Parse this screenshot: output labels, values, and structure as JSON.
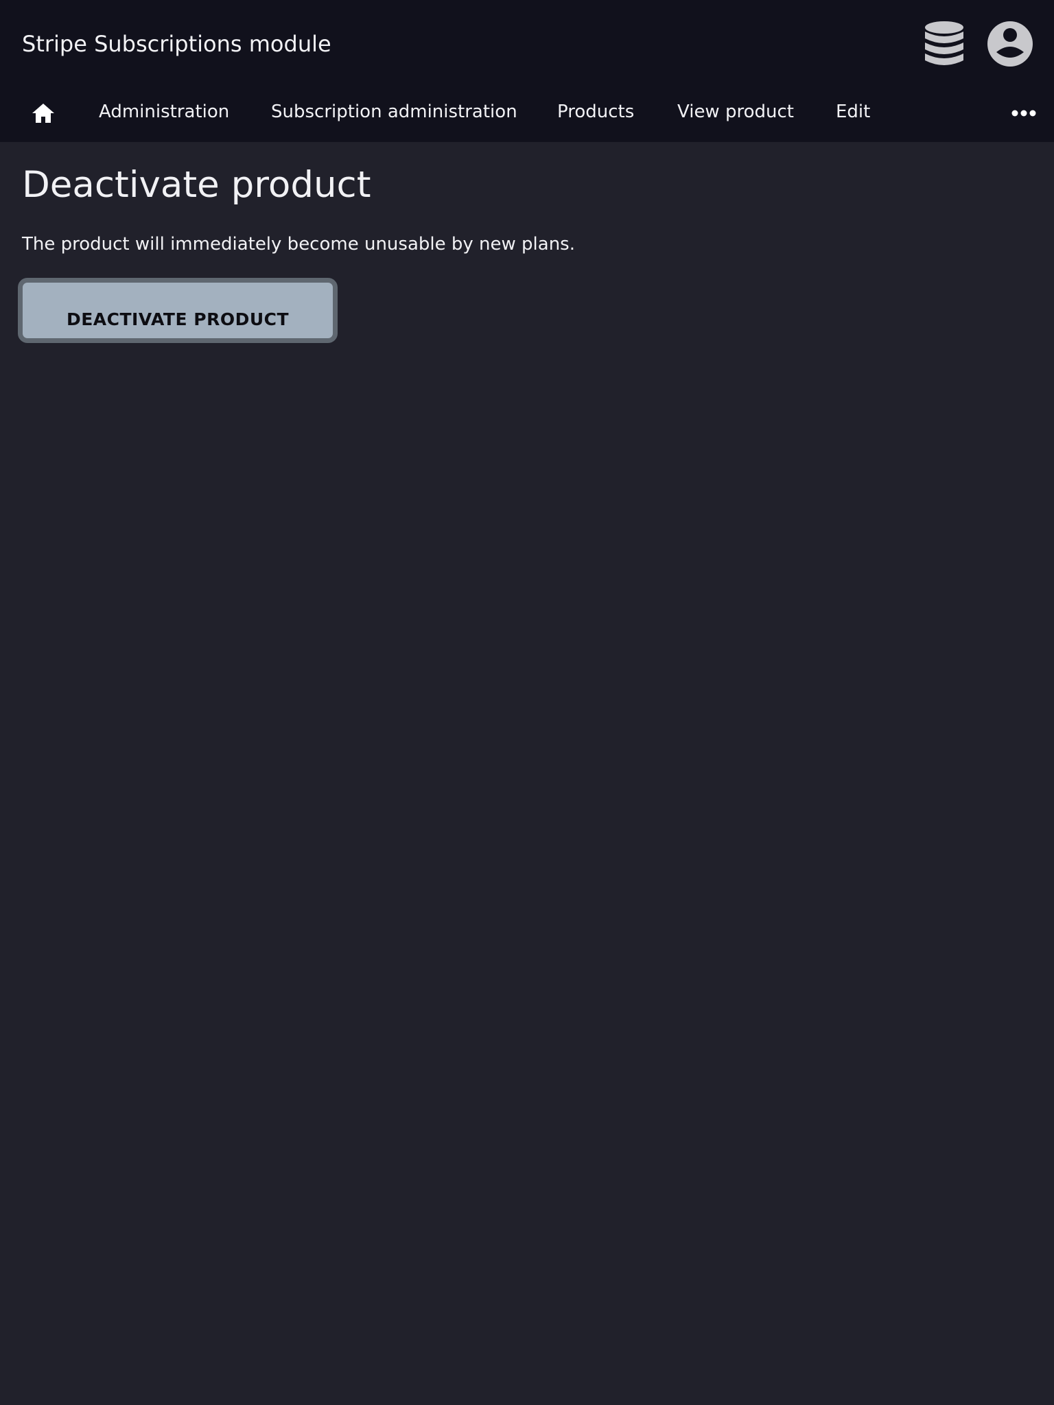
{
  "header": {
    "title": "Stripe Subscriptions module",
    "icons": [
      "database-icon",
      "account-icon"
    ]
  },
  "nav": {
    "home_icon": "home-icon",
    "items": [
      {
        "label": "Administration"
      },
      {
        "label": "Subscription administration"
      },
      {
        "label": "Products"
      },
      {
        "label": "View product"
      },
      {
        "label": "Edit"
      }
    ],
    "more_icon": "more-horizontal-icon"
  },
  "main": {
    "title": "Deactivate product",
    "description": "The product will immediately become unusable by new plans.",
    "button_label": "DEACTIVATE PRODUCT"
  },
  "colors": {
    "header_bg": "#11111c",
    "page_bg": "#21212b",
    "button_bg": "#a3b1bf",
    "button_border": "#5f6770",
    "icon_fill": "#c8c8cc"
  }
}
